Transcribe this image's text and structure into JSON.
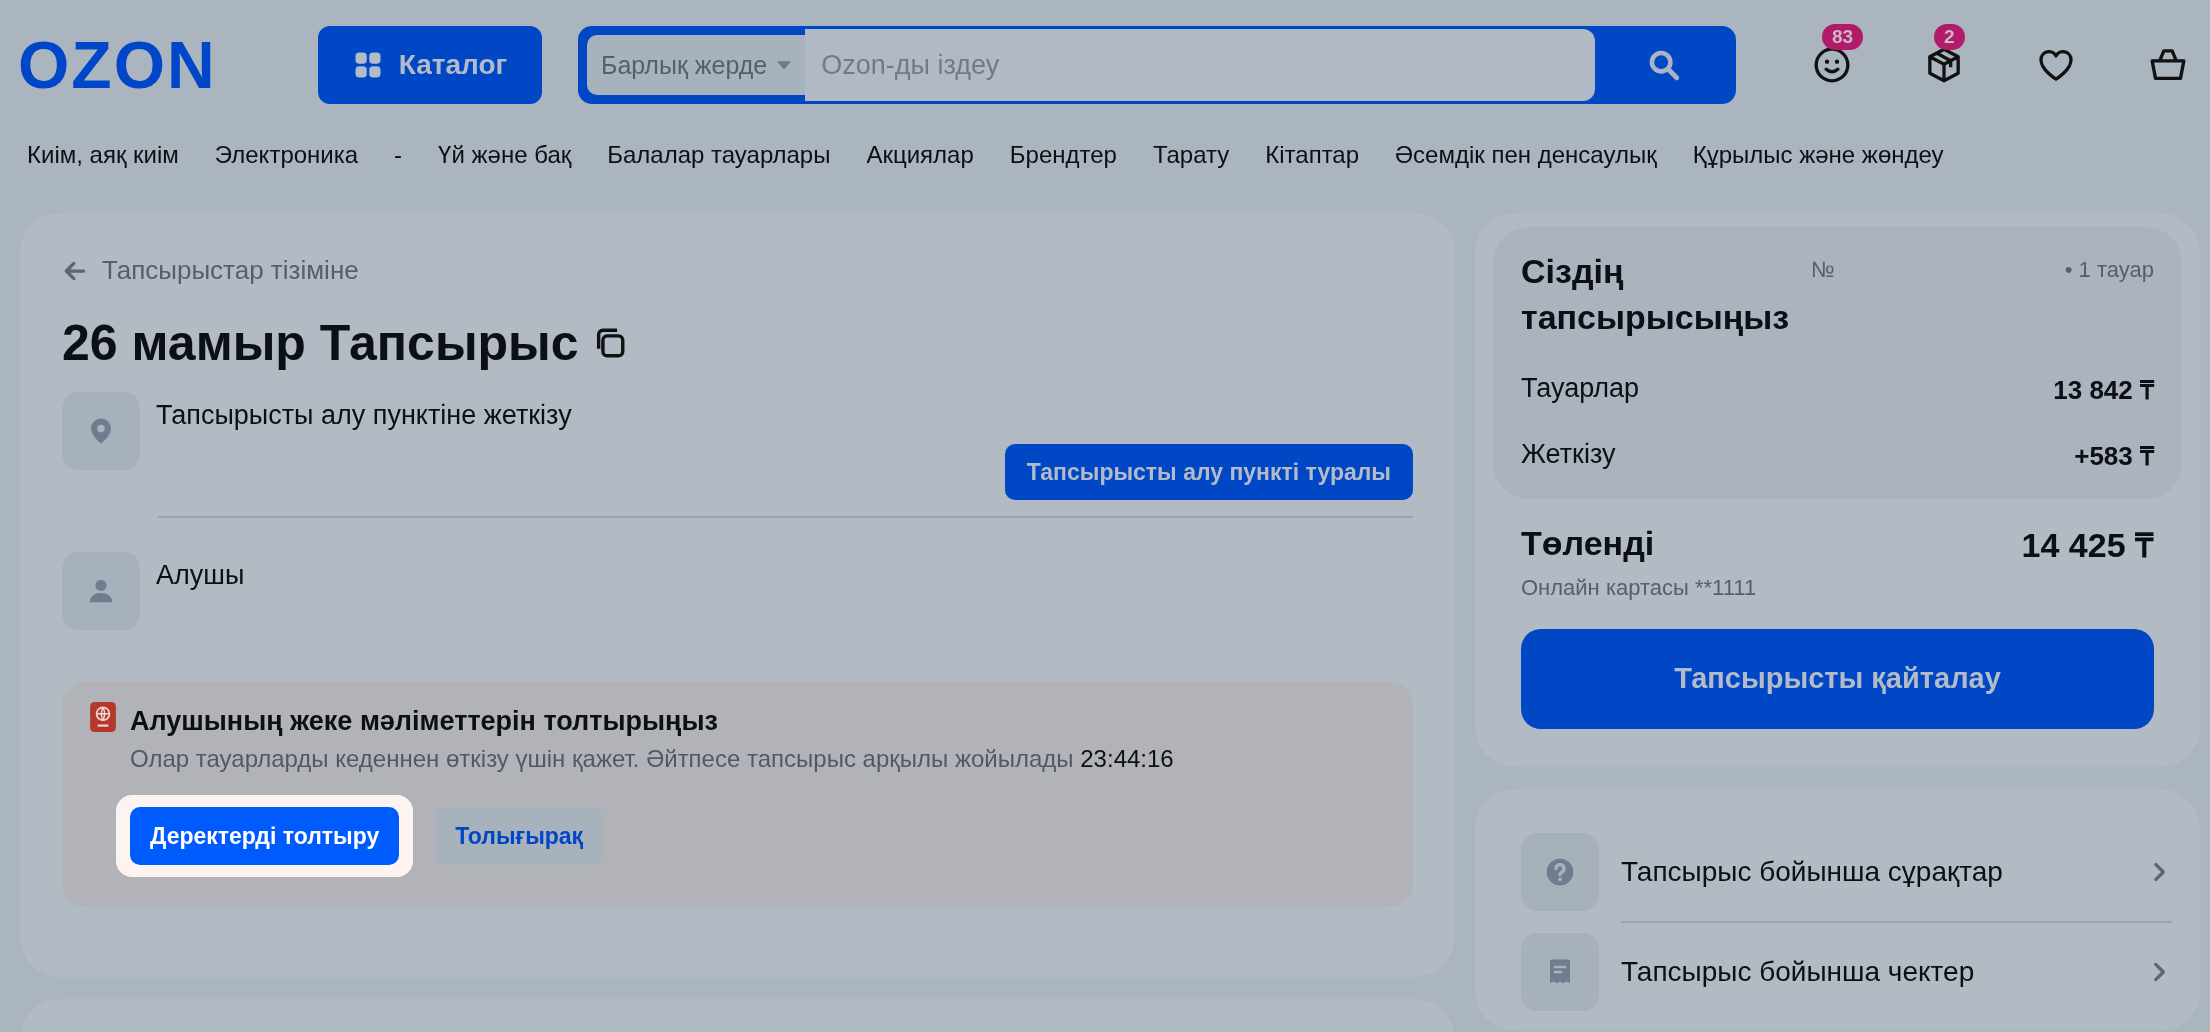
{
  "header": {
    "logo": "OZON",
    "catalog_button": "Каталог",
    "search": {
      "scope": "Барлық жерде",
      "placeholder": "Ozon-ды іздеу"
    },
    "icons": [
      {
        "kind": "face",
        "badge": "83"
      },
      {
        "kind": "box",
        "badge": "2"
      },
      {
        "kind": "heart"
      },
      {
        "kind": "bag"
      }
    ]
  },
  "nav": [
    "Киім, аяқ киім",
    "Электроника",
    "-",
    "Үй және бақ",
    "Балалар тауарлары",
    "Акциялар",
    "Брендтер",
    "Тарату",
    "Кітаптар",
    "Әсемдік пен денсаулық",
    "Құрылыс және жөндеу"
  ],
  "order": {
    "back_link": "Тапсырыстар тізіміне",
    "title": "26 мамыр Тапсырыс",
    "delivery": {
      "text": "Тапсырысты алу пунктіне жеткізу",
      "button": "Тапсырысты алу пункті туралы"
    },
    "recipient": {
      "label": "Алушы"
    },
    "notice": {
      "title": "Алушының жеке мәліметтерін толтырыңыз",
      "text": "Олар тауарларды кеденнен өткізу үшін қажет. Әйтпесе тапсырыс арқылы жойылады",
      "timer": "23:44:16",
      "buttons": [
        {
          "label": "Деректерді толтыру",
          "kind": "primary",
          "highlighted": true
        },
        {
          "label": "Толығырақ",
          "kind": "secondary",
          "highlighted": false
        }
      ]
    }
  },
  "summary": {
    "title": "Сіздің тапсырысыңыз",
    "number_label": "№",
    "count": "• 1 тауар",
    "rows": [
      {
        "label": "Тауарлар",
        "value": "13 842 ₸"
      },
      {
        "label": "Жеткізу",
        "value": "+583 ₸"
      }
    ],
    "paid": {
      "label": "Төленді",
      "value": "14 425 ₸",
      "method": "Онлайн картасы **1111"
    },
    "repeat_button": "Тапсырысты қайталау"
  },
  "links": [
    {
      "kind": "question",
      "label": "Тапсырыс бойынша сұрақтар"
    },
    {
      "kind": "receipt",
      "label": "Тапсырыс бойынша чектер"
    }
  ]
}
